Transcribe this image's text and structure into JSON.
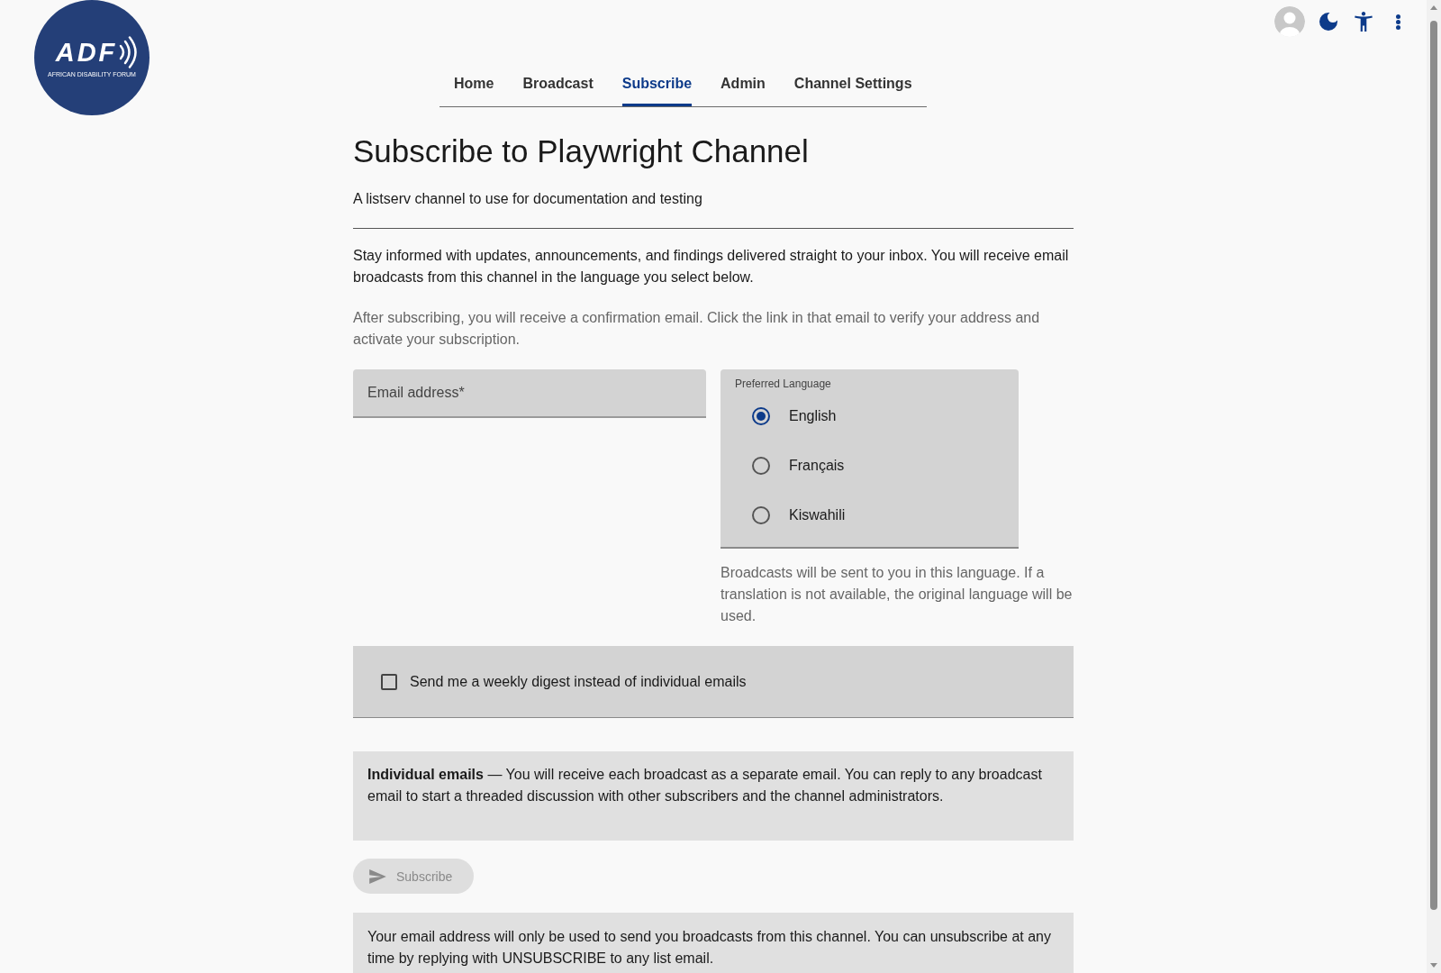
{
  "logo": {
    "wordmark": "ADF",
    "tagline": "AFRICAN DISABILITY FORUM"
  },
  "nav": {
    "tabs": [
      {
        "label": "Home",
        "selected": false
      },
      {
        "label": "Broadcast",
        "selected": false
      },
      {
        "label": "Subscribe",
        "selected": true
      },
      {
        "label": "Admin",
        "selected": false
      },
      {
        "label": "Channel Settings",
        "selected": false
      }
    ]
  },
  "header": {
    "title": "Subscribe to Playwright Channel",
    "description": "A listserv channel to use for documentation and testing"
  },
  "intro": "Stay informed with updates, announcements, and findings delivered straight to your inbox. You will receive email broadcasts from this channel in the language you select below.",
  "confirmation_note": "After subscribing, you will receive a confirmation email. Click the link in that email to verify your address and activate your subscription.",
  "form": {
    "email": {
      "placeholder": "Email address*"
    },
    "language": {
      "label": "Preferred Language",
      "options": [
        {
          "label": "English",
          "selected": true
        },
        {
          "label": "Français",
          "selected": false
        },
        {
          "label": "Kiswahili",
          "selected": false
        }
      ],
      "helper": "Broadcasts will be sent to you in this language. If a translation is not available, the original language will be used."
    },
    "digest": {
      "label": "Send me a weekly digest instead of individual emails",
      "checked": false
    },
    "delivery_info": "**Individual emails** — You will receive each broadcast as a separate email. You can reply to any broadcast email to start a threaded discussion with other subscribers and the channel administrators.",
    "submit": {
      "label": "Subscribe",
      "disabled": true
    }
  },
  "privacy_note": "Your email address will only be used to send you broadcasts from this channel. You can unsubscribe at any time by replying with UNSUBSCRIBE to any list email."
}
